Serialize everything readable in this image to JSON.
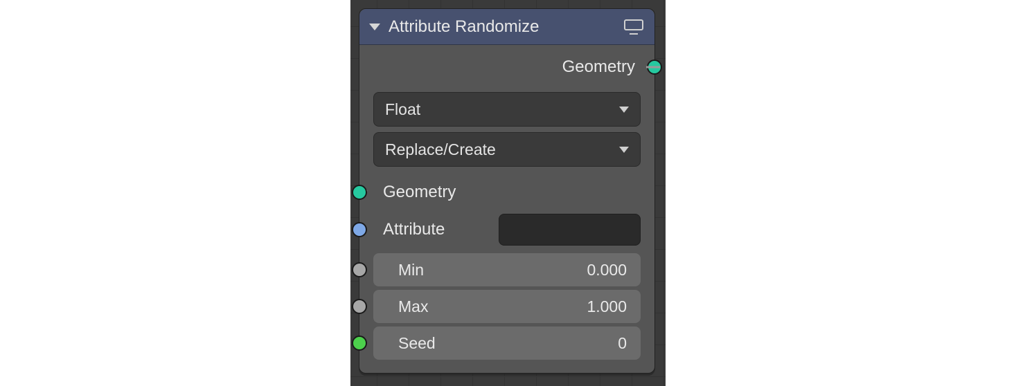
{
  "node": {
    "title": "Attribute Randomize",
    "outputs": {
      "geometry": "Geometry"
    },
    "dropdowns": {
      "data_type": "Float",
      "operation": "Replace/Create"
    },
    "inputs": {
      "geometry": "Geometry",
      "attribute_label": "Attribute",
      "attribute_value": "",
      "min_label": "Min",
      "min_value": "0.000",
      "max_label": "Max",
      "max_value": "1.000",
      "seed_label": "Seed",
      "seed_value": "0"
    }
  },
  "colors": {
    "header": "#47516f",
    "body": "#555555",
    "socket_geometry": "#26c9a0",
    "socket_attribute": "#7ea8e6",
    "socket_float": "#a7a7a7",
    "socket_int": "#4cd04c"
  }
}
